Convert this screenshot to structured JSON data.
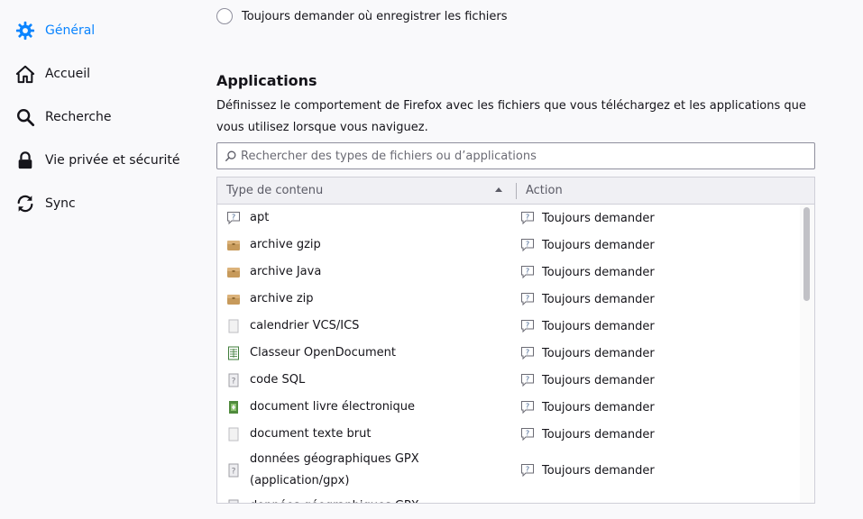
{
  "sidebar": {
    "items": [
      {
        "label": "Général",
        "icon": "gear-icon",
        "active": true
      },
      {
        "label": "Accueil",
        "icon": "home-icon"
      },
      {
        "label": "Recherche",
        "icon": "search-icon"
      },
      {
        "label": "Vie privée et sécurité",
        "icon": "lock-icon"
      },
      {
        "label": "Sync",
        "icon": "sync-icon"
      }
    ]
  },
  "downloads": {
    "radio_label": "Toujours demander où enregistrer les fichiers"
  },
  "applications": {
    "title": "Applications",
    "description": "Définissez le comportement de Firefox avec les fichiers que vous téléchargez et les applications que vous utilisez lorsque vous naviguez.",
    "search_placeholder": "Rechercher des types de fichiers ou d’applications",
    "columns": {
      "type": "Type de contenu",
      "action": "Action"
    },
    "rows": [
      {
        "type": "apt",
        "icon": "chat-question-icon",
        "action": "Toujours demander"
      },
      {
        "type": "archive gzip",
        "icon": "package-icon",
        "action": "Toujours demander"
      },
      {
        "type": "archive Java",
        "icon": "package-icon",
        "action": "Toujours demander"
      },
      {
        "type": "archive zip",
        "icon": "package-icon",
        "action": "Toujours demander"
      },
      {
        "type": "calendrier VCS/ICS",
        "icon": "blank-file-icon",
        "action": "Toujours demander"
      },
      {
        "type": "Classeur OpenDocument",
        "icon": "spreadsheet-icon",
        "action": "Toujours demander"
      },
      {
        "type": "code SQL",
        "icon": "unknown-file-icon",
        "action": "Toujours demander"
      },
      {
        "type": "document livre électronique",
        "icon": "ebook-icon",
        "action": "Toujours demander"
      },
      {
        "type": "document texte brut",
        "icon": "blank-file-icon",
        "action": "Toujours demander"
      },
      {
        "type": "données géographiques GPX (application/gpx)",
        "icon": "unknown-file-icon",
        "action": "Toujours demander"
      },
      {
        "type": "données géographiques GPX",
        "icon": "unknown-file-icon",
        "action": ""
      }
    ]
  },
  "colors": {
    "accent": "#0a84ff",
    "text": "#15141a",
    "muted": "#5b5b66",
    "background": "#f9f9fb"
  }
}
